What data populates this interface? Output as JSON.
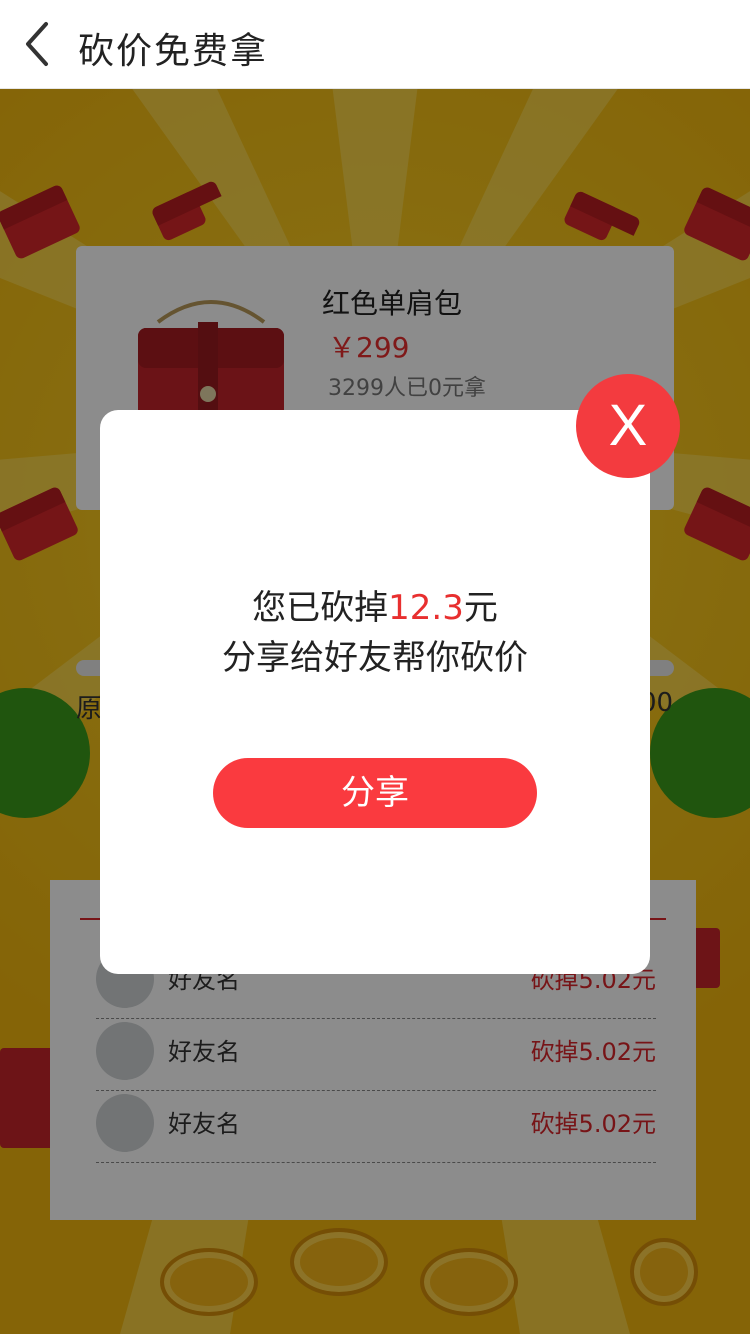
{
  "nav": {
    "title": "砍价免费拿",
    "back_icon": "chevron-left-icon"
  },
  "product": {
    "name": "红色单肩包",
    "price": "￥299",
    "claimed": "3299人已0元拿"
  },
  "original_price": {
    "label": "原",
    "value_fragment": "00"
  },
  "friends": [
    {
      "name": "好友名",
      "cut": "砍掉5.02元"
    },
    {
      "name": "好友名",
      "cut": "砍掉5.02元"
    },
    {
      "name": "好友名",
      "cut": "砍掉5.02元"
    }
  ],
  "modal": {
    "line1_prefix": "您已砍掉",
    "line1_amount": "12.3",
    "line1_suffix": "元",
    "line2": "分享给好友帮你砍价",
    "share_label": "分享",
    "close_label": "X"
  },
  "colors": {
    "accent_red": "#fa3a3f",
    "price_red": "#e82f2f",
    "background_yellow": "#f2c21a"
  }
}
